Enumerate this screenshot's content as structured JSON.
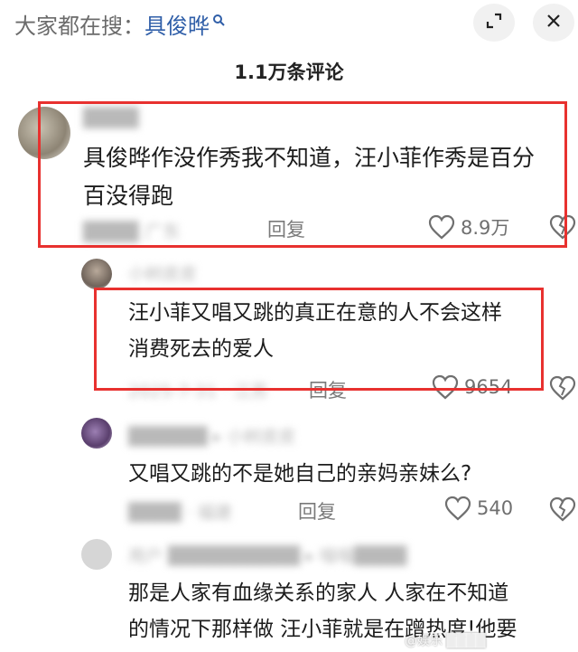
{
  "top_bar": {
    "hot_search_prefix": "大家都在搜：",
    "hot_search_term": "具俊晔",
    "search_icon": "search-icon",
    "expand_icon": "expand-icon",
    "close_icon": "close-icon"
  },
  "header": {
    "comment_count_title": "1.1万条评论"
  },
  "comments": [
    {
      "username": "████",
      "text_line1": "具俊晔作没作秀我不知道，汪小菲作秀是百分",
      "text_line2": "百没得跑",
      "meta": "████ 广东",
      "reply_label": "回复",
      "likes": "8.9万"
    },
    {
      "username": "小树皮皮",
      "text_line1": "汪小菲又唱又跳的真正在意的人不会这样",
      "text_line2": "消费死去的爱人",
      "meta": "2025-7-31 · 江苏",
      "reply_label": "回复",
      "likes": "9654"
    },
    {
      "username": "██████ ▸ 小树皮皮",
      "text_line1": "又唱又跳的不是她自己的亲妈亲妹么?",
      "meta": "████ · 福建",
      "reply_label": "回复",
      "likes": "540"
    },
    {
      "username": "用户 ██████████ ▸ 喵喵████",
      "text_line1": "那是人家有血缘关系的家人 人家在不知道",
      "text_line2": "的情况下那样做 汪小菲就是在蹭热度!他要"
    }
  ],
  "watermark": "@娱乐 ████"
}
